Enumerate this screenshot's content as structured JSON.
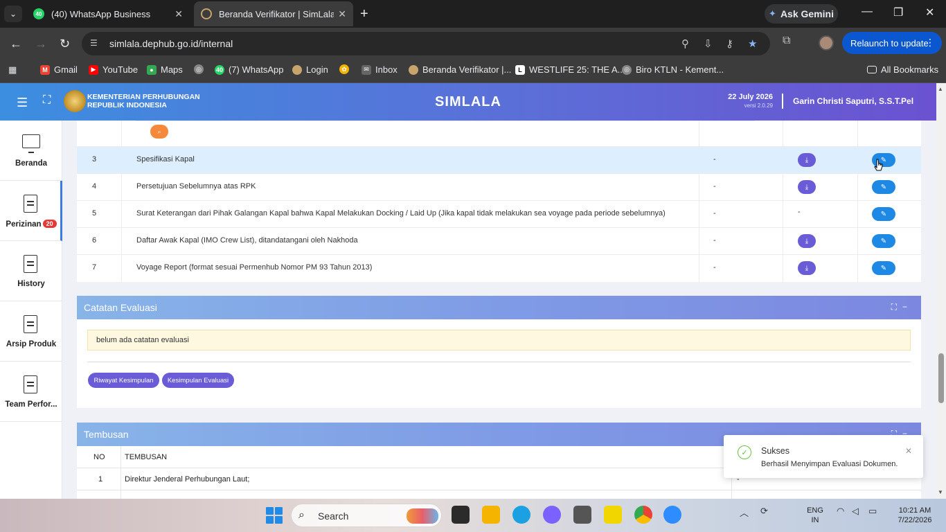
{
  "browser": {
    "tabs": [
      {
        "title": "(40) WhatsApp Business",
        "badge": "40"
      },
      {
        "title": "Beranda Verifikator | SimLala"
      }
    ],
    "ask_gemini": "Ask Gemini",
    "url": "simlala.dephub.go.id/internal",
    "relaunch": "Relaunch to update",
    "bookmarks": [
      {
        "label": "Gmail"
      },
      {
        "label": "YouTube"
      },
      {
        "label": "Maps"
      },
      {
        "label": "(7) WhatsApp",
        "badge": "40"
      },
      {
        "label": "Login"
      },
      {
        "label": "Inbox"
      },
      {
        "label": "Beranda Verifikator |..."
      },
      {
        "label": "WESTLIFE 25: THE A..."
      },
      {
        "label": "Biro KTLN - Kement..."
      },
      {
        "label": "All Bookmarks"
      }
    ]
  },
  "header": {
    "ministry_line1": "KEMENTERIAN PERHUBUNGAN",
    "ministry_line2": "REPUBLIK INDONESIA",
    "app_title": "SIMLALA",
    "date": "22 July 2026",
    "version": "versi 2.0.29",
    "user_name": "Garin Christi Saputri, S.S.T.Pel"
  },
  "sidebar": {
    "items": [
      {
        "label": "Beranda",
        "icon": "monitor-icon"
      },
      {
        "label": "Perizinan",
        "badge": "20",
        "icon": "document-icon"
      },
      {
        "label": "History",
        "icon": "document-icon"
      },
      {
        "label": "Arsip Produk",
        "icon": "document-icon"
      },
      {
        "label": "Team Perfor...",
        "icon": "document-icon"
      }
    ]
  },
  "documents": {
    "rows": [
      {
        "no": "3",
        "name": "Spesifikasi Kapal",
        "status": "-",
        "has_download": true
      },
      {
        "no": "4",
        "name": "Persetujuan Sebelumnya atas RPK",
        "status": "-",
        "has_download": true
      },
      {
        "no": "5",
        "name": "Surat Keterangan dari Pihak Galangan Kapal bahwa Kapal Melakukan Docking / Laid Up (Jika kapal tidak melakukan sea voyage pada periode sebelumnya)",
        "status": "-",
        "has_download": false,
        "file_dash": "-"
      },
      {
        "no": "6",
        "name": "Daftar Awak Kapal (IMO Crew List), ditandatangani oleh Nakhoda",
        "status": "-",
        "has_download": true
      },
      {
        "no": "7",
        "name": "Voyage Report (format sesuai Permenhub Nomor PM 93 Tahun 2013)",
        "status": "-",
        "has_download": true
      }
    ]
  },
  "evaluation": {
    "title": "Catatan Evaluasi",
    "note": "belum ada catatan evaluasi",
    "btn_history": "Riwayat Kesimpulan",
    "btn_conclusion": "Kesimpulan Evaluasi"
  },
  "tembusan": {
    "title": "Tembusan",
    "col_no": "NO",
    "col_name": "TEMBUSAN",
    "rows": [
      {
        "no": "1",
        "name": "Direktur Jenderal Perhubungan Laut;",
        "extra": "-"
      }
    ]
  },
  "toast": {
    "title": "Sukses",
    "message": "Berhasil Menyimpan Evaluasi Dokumen."
  },
  "taskbar": {
    "search": "Search",
    "lang_top": "ENG",
    "lang_bottom": "IN",
    "time": "10:21 AM",
    "date": "7/22/2026"
  }
}
